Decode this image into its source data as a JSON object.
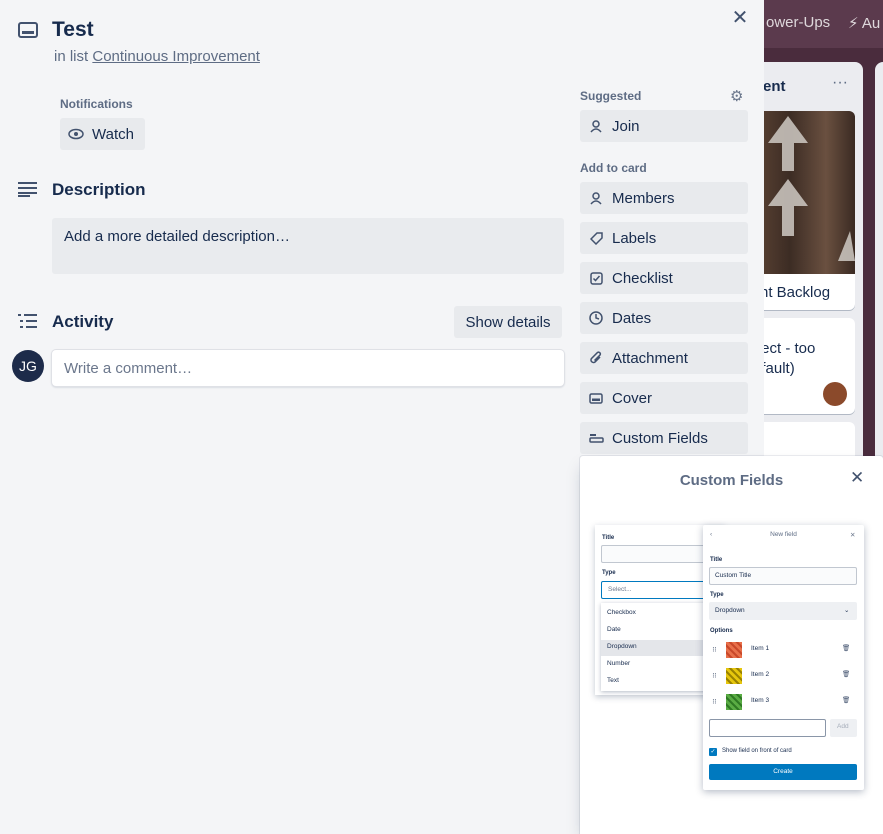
{
  "board": {
    "top_items": [
      "ower-Ups",
      "Au"
    ],
    "list_header": "ent",
    "card1_text": "nt Backlog",
    "card2_text_line1": "fect - too",
    "card2_text_line2": "efault)"
  },
  "card": {
    "title": "Test",
    "in_list_prefix": "in list",
    "list_name": "Continuous Improvement",
    "notifications_label": "Notifications",
    "watch_label": "Watch",
    "description_heading": "Description",
    "description_placeholder": "Add a more detailed description…",
    "activity_heading": "Activity",
    "show_details_label": "Show details",
    "comment_placeholder": "Write a comment…",
    "avatar_initials": "JG"
  },
  "sidebar": {
    "suggested_label": "Suggested",
    "join_label": "Join",
    "add_to_card_label": "Add to card",
    "items": [
      {
        "label": "Members",
        "icon": "person-icon"
      },
      {
        "label": "Labels",
        "icon": "tag-icon"
      },
      {
        "label": "Checklist",
        "icon": "checklist-icon"
      },
      {
        "label": "Dates",
        "icon": "clock-icon"
      },
      {
        "label": "Attachment",
        "icon": "paperclip-icon"
      },
      {
        "label": "Cover",
        "icon": "cover-icon"
      },
      {
        "label": "Custom Fields",
        "icon": "custom-fields-icon"
      }
    ]
  },
  "popover": {
    "title": "Custom Fields",
    "preview": {
      "back": {
        "title_label": "Title",
        "type_label": "Type",
        "select_placeholder": "Select...",
        "options": [
          "Checkbox",
          "Date",
          "Dropdown",
          "Number",
          "Text"
        ]
      },
      "front": {
        "header": "New field",
        "title_label": "Title",
        "title_value": "Custom Title",
        "type_label": "Type",
        "type_value": "Dropdown",
        "options_label": "Options",
        "items": [
          {
            "label": "Item 1",
            "color": "#e8704a"
          },
          {
            "label": "Item 2",
            "color": "#e6c60d"
          },
          {
            "label": "Item 3",
            "color": "#5aac44"
          }
        ],
        "add_label": "Add",
        "show_on_front_label": "Show field on front of card",
        "create_label": "Create"
      }
    }
  }
}
